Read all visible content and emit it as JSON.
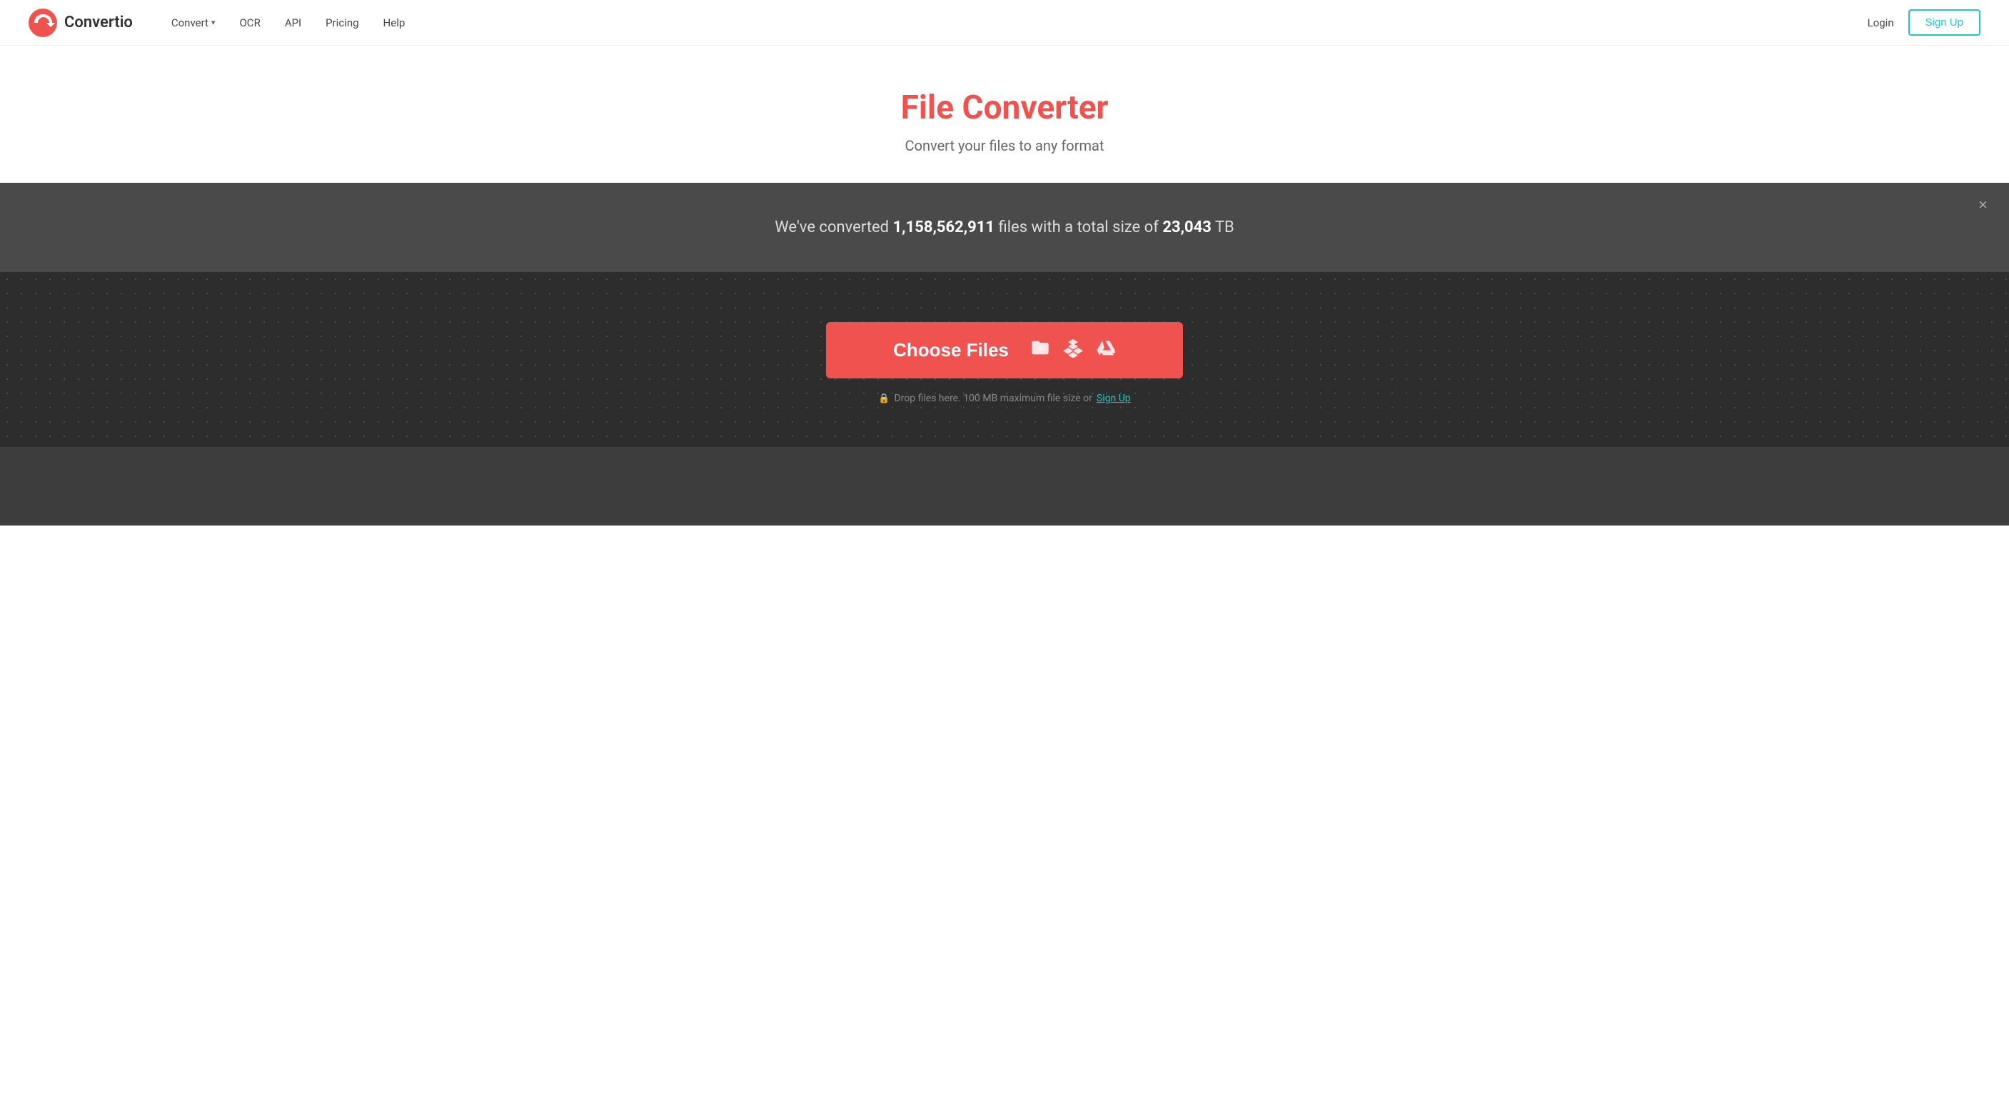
{
  "header": {
    "logo_text": "Convertio",
    "nav_items": [
      {
        "label": "Convert",
        "has_chevron": true
      },
      {
        "label": "OCR",
        "has_chevron": false
      },
      {
        "label": "API",
        "has_chevron": false
      },
      {
        "label": "Pricing",
        "has_chevron": false
      },
      {
        "label": "Help",
        "has_chevron": false
      }
    ],
    "login_label": "Login",
    "signup_label": "Sign Up"
  },
  "hero": {
    "title": "File Converter",
    "subtitle": "Convert your files to any format"
  },
  "stats": {
    "prefix": "We've converted",
    "file_count": "1,158,562,911",
    "middle": "files with a total size of",
    "total_size": "23,043",
    "unit": "TB"
  },
  "upload": {
    "choose_files_label": "Choose Files",
    "drop_hint": "Drop files here. 100 MB maximum file size or",
    "signup_link_label": "Sign Up"
  },
  "close_icon": "×"
}
